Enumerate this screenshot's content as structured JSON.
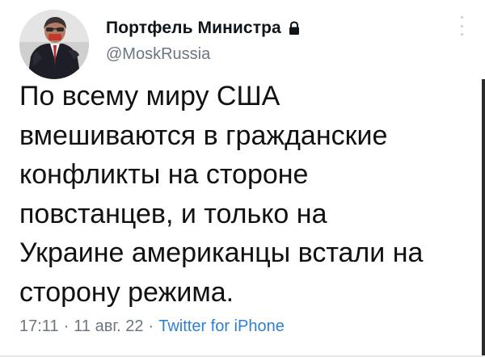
{
  "author": {
    "display_name": "Портфель Министра",
    "handle": "@MoskRussia",
    "avatar_icon": "profile-photo",
    "lock_icon": "lock-icon"
  },
  "tweet": {
    "text": "По всему миру США\nвмешиваются в гражданские\nконфликты на стороне\nповстанцев, и только на\nУкраине американцы встали на\nсторону режима."
  },
  "meta": {
    "time": "17:11",
    "separator": "·",
    "date": "11 авг. 22",
    "source": "Twitter for iPhone"
  },
  "colors": {
    "text": "#111111",
    "secondary": "#6b7680",
    "link": "#2f7fd1"
  }
}
